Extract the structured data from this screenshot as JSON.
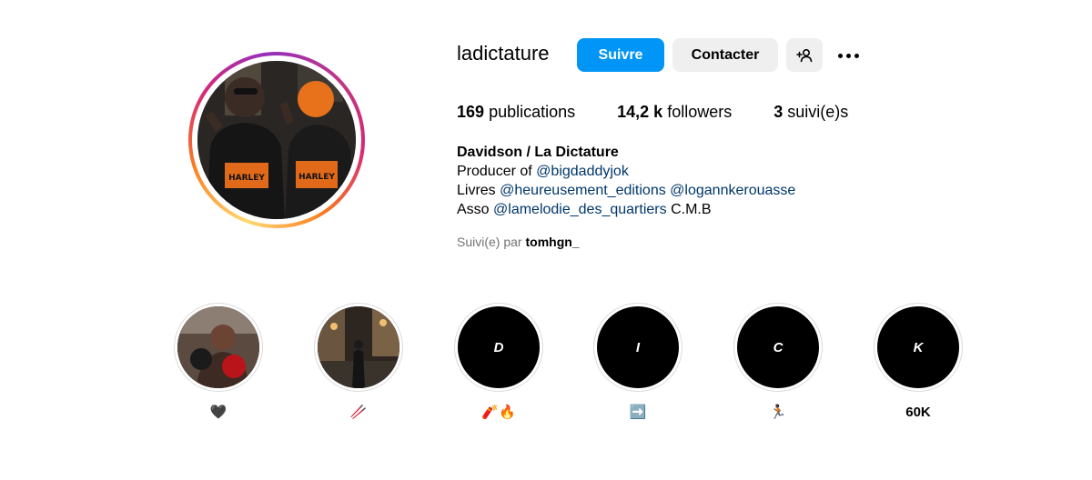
{
  "profile": {
    "username": "ladictature",
    "buttons": {
      "follow": "Suivre",
      "contact": "Contacter"
    },
    "stats": [
      {
        "value": "169",
        "label": "publications"
      },
      {
        "value": "14,2 k",
        "label": "followers"
      },
      {
        "value": "3",
        "label": "suivi(e)s"
      }
    ],
    "bio": {
      "name": "Davidson / La Dictature",
      "line1_prefix": "Producer of",
      "line1_mention": "@bigdaddyjok",
      "line2_prefix": "Livres",
      "line2_mention1": "@heureusement_editions",
      "line2_mention2": "@logannkerouasse",
      "line3_prefix": "Asso",
      "line3_mention": "@lamelodie_des_quartiers",
      "line3_suffix": "C.M.B"
    },
    "followed_by": {
      "prefix": "Suivi(e) par",
      "user": "tomhgn_"
    }
  },
  "highlights": [
    {
      "cover": "",
      "label": "🖤",
      "type": "photo-boxing"
    },
    {
      "cover": "",
      "label": "🥢",
      "type": "photo-street"
    },
    {
      "cover": "D",
      "label": "🧨🔥",
      "type": "letter"
    },
    {
      "cover": "I",
      "label": "➡️",
      "type": "letter"
    },
    {
      "cover": "C",
      "label": "🏃🏿",
      "type": "letter"
    },
    {
      "cover": "K",
      "label": "60K",
      "type": "letter"
    }
  ],
  "colors": {
    "accent": "#0095f6",
    "secondary_button": "#efefef",
    "mention": "#00376b",
    "muted": "#737373"
  }
}
